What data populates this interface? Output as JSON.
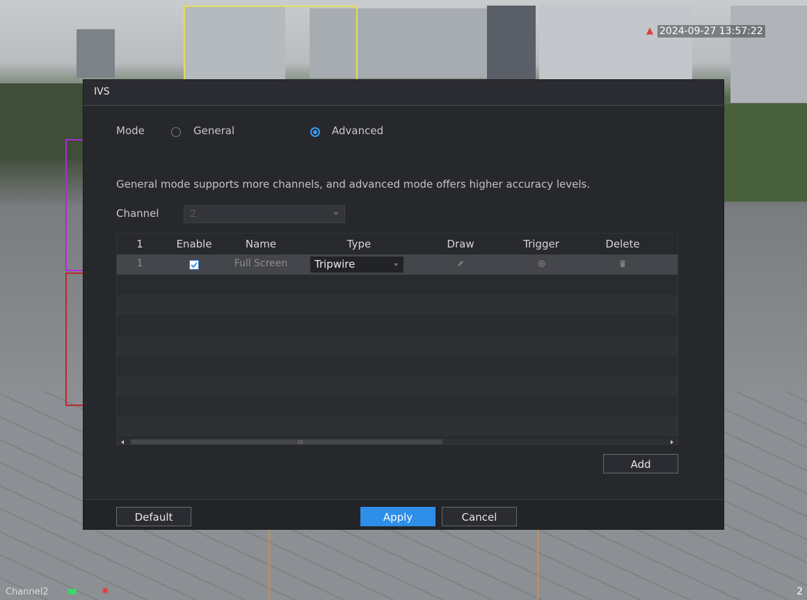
{
  "overlay": {
    "timestamp": "2024-09-27 13:57:22",
    "channel_label": "Channel2",
    "corner_number": "2"
  },
  "dialog": {
    "title": "IVS",
    "mode": {
      "label": "Mode",
      "options": [
        "General",
        "Advanced"
      ],
      "selected": "Advanced"
    },
    "description": "General mode supports more channels, and advanced mode offers higher accuracy levels.",
    "channel": {
      "label": "Channel",
      "value": "2"
    },
    "table": {
      "headers": [
        "1",
        "Enable",
        "Name",
        "Type",
        "Draw",
        "Trigger",
        "Delete"
      ],
      "rows": [
        {
          "index": "1",
          "enabled": true,
          "name": "Full Screen",
          "type": "Tripwire"
        }
      ]
    },
    "buttons": {
      "add": "Add",
      "default": "Default",
      "apply": "Apply",
      "cancel": "Cancel"
    }
  },
  "colors": {
    "accent": "#2e8ee8",
    "dialog_bg": "#27282c"
  }
}
